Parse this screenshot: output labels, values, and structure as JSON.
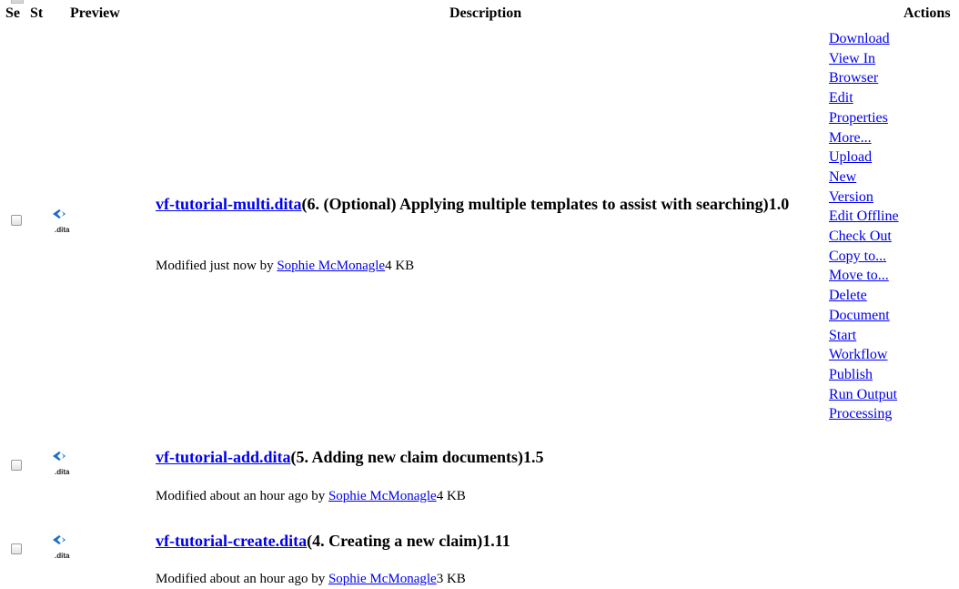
{
  "table": {
    "headers": {
      "select": "Se",
      "status": "St",
      "preview": "Preview",
      "description": "Description",
      "actions": "Actions"
    }
  },
  "rows": [
    {
      "name": "vf-tutorial-multi.dita",
      "title": "(6. (Optional) Applying multiple templates to assist with searching)",
      "version": "1.0",
      "modified_prefix": "Modified just now by ",
      "modified_by": "Sophie McMonagle",
      "size": "4 KB",
      "icon": "dita-file-icon",
      "icon_label": ".dita"
    },
    {
      "name": "vf-tutorial-add.dita",
      "title": "(5. Adding new claim documents)",
      "version": "1.5",
      "modified_prefix": "Modified about an hour ago by ",
      "modified_by": "Sophie McMonagle",
      "size": "4 KB",
      "icon": "dita-file-icon",
      "icon_label": ".dita"
    },
    {
      "name": "vf-tutorial-create.dita",
      "title": "(4. Creating a new claim)",
      "version": "1.11",
      "modified_prefix": "Modified about an hour ago by ",
      "modified_by": "Sophie McMonagle",
      "size": "3 KB",
      "icon": "dita-file-icon",
      "icon_label": ".dita"
    }
  ],
  "actions": [
    "Download",
    "View In",
    "Browser",
    "Edit",
    "Properties",
    "More...",
    "Upload",
    "New",
    "Version",
    "Edit Offline",
    "Check Out",
    "Copy to...",
    "Move to...",
    "Delete",
    "Document",
    "Start",
    "Workflow",
    "Publish",
    "Run Output",
    "Processing"
  ],
  "colors": {
    "link": "#0000ee",
    "icon_accent": "#1a6fc4"
  }
}
